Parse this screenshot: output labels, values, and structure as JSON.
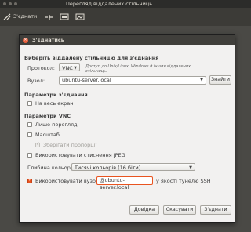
{
  "window": {
    "title": "Перегляд віддалених стільниць"
  },
  "toolbar": {
    "connect_label": "З'єднати"
  },
  "dialog": {
    "title": "З'єднатись",
    "section_choose": "Виберіть віддалену стільницю для з'єднання",
    "protocol_label": "Протокол:",
    "protocol_value": "VNC",
    "protocol_note_line1": "Доступ до Unix/Linux, Windows й інших віддалених",
    "protocol_note_line2": "стільниць.",
    "host_label": "Вузол:",
    "host_value": "ubuntu-server.local",
    "find_button": "Знайти",
    "section_connection": "Параметри з'єднання",
    "fullscreen_label": "На весь екран",
    "section_vnc": "Параметри VNC",
    "viewonly_label": "Лише перегляд",
    "scaling_label": "Масштаб",
    "keep_ratio_label": "Зберігати пропорції",
    "jpeg_label": "Використовувати стиснення JPEG",
    "depth_label": "Глибина кольору:",
    "depth_value": "Тисячі кольорів (16 біти)",
    "ssh_label": "Використовувати вузол",
    "ssh_value": "@ubuntu-server.local",
    "ssh_suffix": "у якості тунелю SSH",
    "help_button": "Довідка",
    "cancel_button": "Скасувати",
    "connect_button": "З'єднати"
  }
}
